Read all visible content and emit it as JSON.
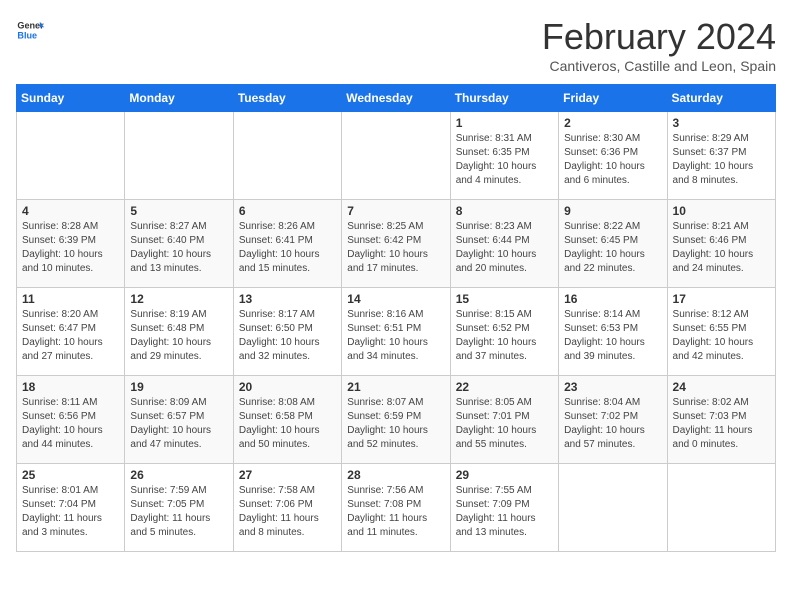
{
  "header": {
    "logo_line1": "General",
    "logo_line2": "Blue",
    "month_title": "February 2024",
    "subtitle": "Cantiveros, Castille and Leon, Spain"
  },
  "days_of_week": [
    "Sunday",
    "Monday",
    "Tuesday",
    "Wednesday",
    "Thursday",
    "Friday",
    "Saturday"
  ],
  "weeks": [
    [
      {
        "day": "",
        "info": ""
      },
      {
        "day": "",
        "info": ""
      },
      {
        "day": "",
        "info": ""
      },
      {
        "day": "",
        "info": ""
      },
      {
        "day": "1",
        "info": "Sunrise: 8:31 AM\nSunset: 6:35 PM\nDaylight: 10 hours\nand 4 minutes."
      },
      {
        "day": "2",
        "info": "Sunrise: 8:30 AM\nSunset: 6:36 PM\nDaylight: 10 hours\nand 6 minutes."
      },
      {
        "day": "3",
        "info": "Sunrise: 8:29 AM\nSunset: 6:37 PM\nDaylight: 10 hours\nand 8 minutes."
      }
    ],
    [
      {
        "day": "4",
        "info": "Sunrise: 8:28 AM\nSunset: 6:39 PM\nDaylight: 10 hours\nand 10 minutes."
      },
      {
        "day": "5",
        "info": "Sunrise: 8:27 AM\nSunset: 6:40 PM\nDaylight: 10 hours\nand 13 minutes."
      },
      {
        "day": "6",
        "info": "Sunrise: 8:26 AM\nSunset: 6:41 PM\nDaylight: 10 hours\nand 15 minutes."
      },
      {
        "day": "7",
        "info": "Sunrise: 8:25 AM\nSunset: 6:42 PM\nDaylight: 10 hours\nand 17 minutes."
      },
      {
        "day": "8",
        "info": "Sunrise: 8:23 AM\nSunset: 6:44 PM\nDaylight: 10 hours\nand 20 minutes."
      },
      {
        "day": "9",
        "info": "Sunrise: 8:22 AM\nSunset: 6:45 PM\nDaylight: 10 hours\nand 22 minutes."
      },
      {
        "day": "10",
        "info": "Sunrise: 8:21 AM\nSunset: 6:46 PM\nDaylight: 10 hours\nand 24 minutes."
      }
    ],
    [
      {
        "day": "11",
        "info": "Sunrise: 8:20 AM\nSunset: 6:47 PM\nDaylight: 10 hours\nand 27 minutes."
      },
      {
        "day": "12",
        "info": "Sunrise: 8:19 AM\nSunset: 6:48 PM\nDaylight: 10 hours\nand 29 minutes."
      },
      {
        "day": "13",
        "info": "Sunrise: 8:17 AM\nSunset: 6:50 PM\nDaylight: 10 hours\nand 32 minutes."
      },
      {
        "day": "14",
        "info": "Sunrise: 8:16 AM\nSunset: 6:51 PM\nDaylight: 10 hours\nand 34 minutes."
      },
      {
        "day": "15",
        "info": "Sunrise: 8:15 AM\nSunset: 6:52 PM\nDaylight: 10 hours\nand 37 minutes."
      },
      {
        "day": "16",
        "info": "Sunrise: 8:14 AM\nSunset: 6:53 PM\nDaylight: 10 hours\nand 39 minutes."
      },
      {
        "day": "17",
        "info": "Sunrise: 8:12 AM\nSunset: 6:55 PM\nDaylight: 10 hours\nand 42 minutes."
      }
    ],
    [
      {
        "day": "18",
        "info": "Sunrise: 8:11 AM\nSunset: 6:56 PM\nDaylight: 10 hours\nand 44 minutes."
      },
      {
        "day": "19",
        "info": "Sunrise: 8:09 AM\nSunset: 6:57 PM\nDaylight: 10 hours\nand 47 minutes."
      },
      {
        "day": "20",
        "info": "Sunrise: 8:08 AM\nSunset: 6:58 PM\nDaylight: 10 hours\nand 50 minutes."
      },
      {
        "day": "21",
        "info": "Sunrise: 8:07 AM\nSunset: 6:59 PM\nDaylight: 10 hours\nand 52 minutes."
      },
      {
        "day": "22",
        "info": "Sunrise: 8:05 AM\nSunset: 7:01 PM\nDaylight: 10 hours\nand 55 minutes."
      },
      {
        "day": "23",
        "info": "Sunrise: 8:04 AM\nSunset: 7:02 PM\nDaylight: 10 hours\nand 57 minutes."
      },
      {
        "day": "24",
        "info": "Sunrise: 8:02 AM\nSunset: 7:03 PM\nDaylight: 11 hours\nand 0 minutes."
      }
    ],
    [
      {
        "day": "25",
        "info": "Sunrise: 8:01 AM\nSunset: 7:04 PM\nDaylight: 11 hours\nand 3 minutes."
      },
      {
        "day": "26",
        "info": "Sunrise: 7:59 AM\nSunset: 7:05 PM\nDaylight: 11 hours\nand 5 minutes."
      },
      {
        "day": "27",
        "info": "Sunrise: 7:58 AM\nSunset: 7:06 PM\nDaylight: 11 hours\nand 8 minutes."
      },
      {
        "day": "28",
        "info": "Sunrise: 7:56 AM\nSunset: 7:08 PM\nDaylight: 11 hours\nand 11 minutes."
      },
      {
        "day": "29",
        "info": "Sunrise: 7:55 AM\nSunset: 7:09 PM\nDaylight: 11 hours\nand 13 minutes."
      },
      {
        "day": "",
        "info": ""
      },
      {
        "day": "",
        "info": ""
      }
    ]
  ]
}
